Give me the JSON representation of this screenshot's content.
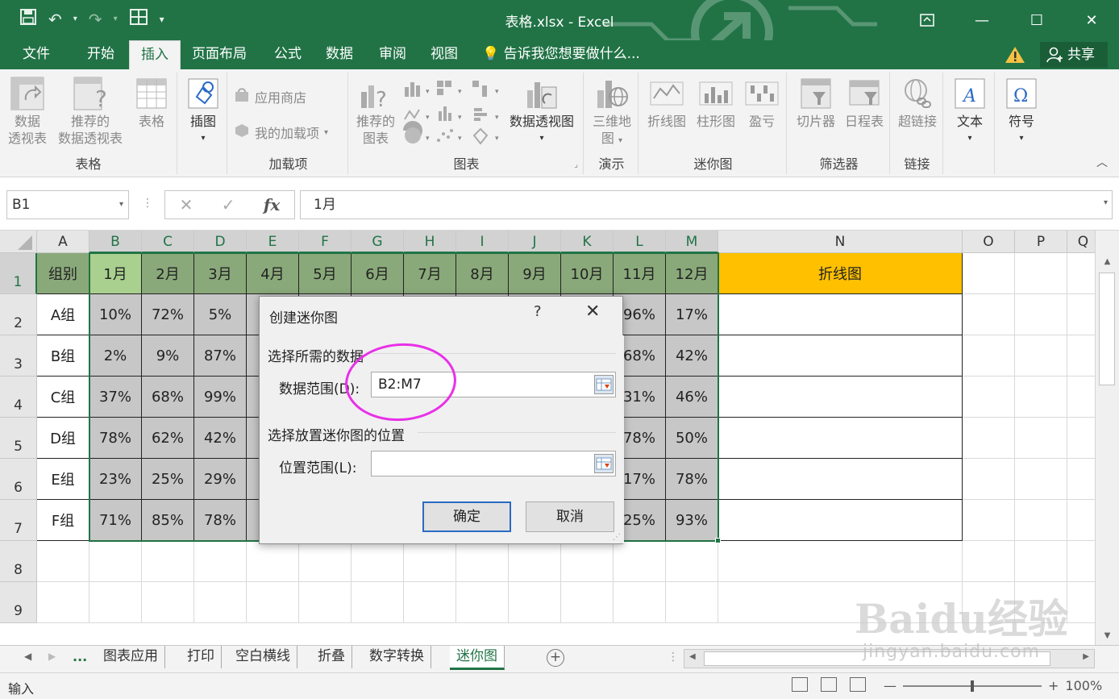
{
  "titlebar": {
    "title": "表格.xlsx - Excel",
    "accent": "#217346"
  },
  "tabs": [
    "文件",
    "开始",
    "插入",
    "页面布局",
    "公式",
    "数据",
    "审阅",
    "视图"
  ],
  "active_tab": "插入",
  "tell_me": "告诉我您想要做什么...",
  "share_label": "共享",
  "ribbon": {
    "groups": {
      "table": "表格",
      "addins": "加载项",
      "charts": "图表",
      "tours": "演示",
      "sparklines": "迷你图",
      "filters": "筛选器",
      "links": "链接"
    },
    "buttons": {
      "pivot_line1": "数据",
      "pivot_line2": "透视表",
      "rec_pivot_line1": "推荐的",
      "rec_pivot_line2": "数据透视表",
      "table": "表格",
      "illustrations": "插图",
      "store": "应用商店",
      "my_addins": "我的加载项",
      "rec_charts_line1": "推荐的",
      "rec_charts_line2": "图表",
      "pivot_chart": "数据透视图",
      "map3d_line1": "三维地",
      "map3d_line2": "图",
      "spark_line": "折线图",
      "spark_column": "柱形图",
      "spark_winloss": "盈亏",
      "slicer": "切片器",
      "timeline": "日程表",
      "hyperlink": "超链接",
      "text": "文本",
      "symbol": "符号"
    }
  },
  "formula_bar": {
    "name_box": "B1",
    "formula": "1月"
  },
  "sheet": {
    "columns": [
      "A",
      "B",
      "C",
      "D",
      "E",
      "F",
      "G",
      "H",
      "I",
      "J",
      "K",
      "L",
      "M",
      "N",
      "O",
      "P",
      "Q"
    ],
    "rows": [
      "1",
      "2",
      "3",
      "4",
      "5",
      "6",
      "7",
      "8",
      "9"
    ],
    "header_row": [
      "组别",
      "1月",
      "2月",
      "3月",
      "4月",
      "5月",
      "6月",
      "7月",
      "8月",
      "9月",
      "10月",
      "11月",
      "12月",
      "折线图"
    ],
    "data": [
      [
        "A组",
        "10%",
        "72%",
        "5%",
        "",
        "",
        "",
        "",
        "",
        "",
        "",
        "96%",
        "17%",
        ""
      ],
      [
        "B组",
        "2%",
        "9%",
        "87%",
        "",
        "",
        "",
        "",
        "",
        "",
        "",
        "68%",
        "42%",
        ""
      ],
      [
        "C组",
        "37%",
        "68%",
        "99%",
        "",
        "",
        "",
        "",
        "",
        "",
        "",
        "31%",
        "46%",
        ""
      ],
      [
        "D组",
        "78%",
        "62%",
        "42%",
        "",
        "",
        "",
        "",
        "",
        "",
        "",
        "78%",
        "50%",
        ""
      ],
      [
        "E组",
        "23%",
        "25%",
        "29%",
        "",
        "",
        "",
        "",
        "",
        "",
        "",
        "17%",
        "78%",
        ""
      ],
      [
        "F组",
        "71%",
        "85%",
        "78%",
        "",
        "",
        "",
        "",
        "",
        "",
        "",
        "25%",
        "93%",
        ""
      ]
    ],
    "colors": {
      "header_green": "#8aa97a",
      "header_green_active": "#a9d08e",
      "data_gray": "#c7c7c7",
      "sparkline_header": "#ffc000"
    }
  },
  "sheet_tabs": [
    "图表应用",
    "打印",
    "空白横线",
    "折叠",
    "数字转换",
    "迷你图"
  ],
  "active_sheet": "迷你图",
  "sheet_more": "...",
  "status": {
    "mode": "输入",
    "zoom": "100%"
  },
  "dialog": {
    "title": "创建迷你图",
    "help": "?",
    "section1": "选择所需的数据",
    "data_range_label": "数据范围(D):",
    "data_range_value": "B2:M7",
    "section2": "选择放置迷你图的位置",
    "location_label": "位置范围(L):",
    "location_value": "",
    "ok": "确定",
    "cancel": "取消"
  },
  "watermark": {
    "line1": "Baidu经验",
    "line2": "jingyan.baidu.com"
  }
}
